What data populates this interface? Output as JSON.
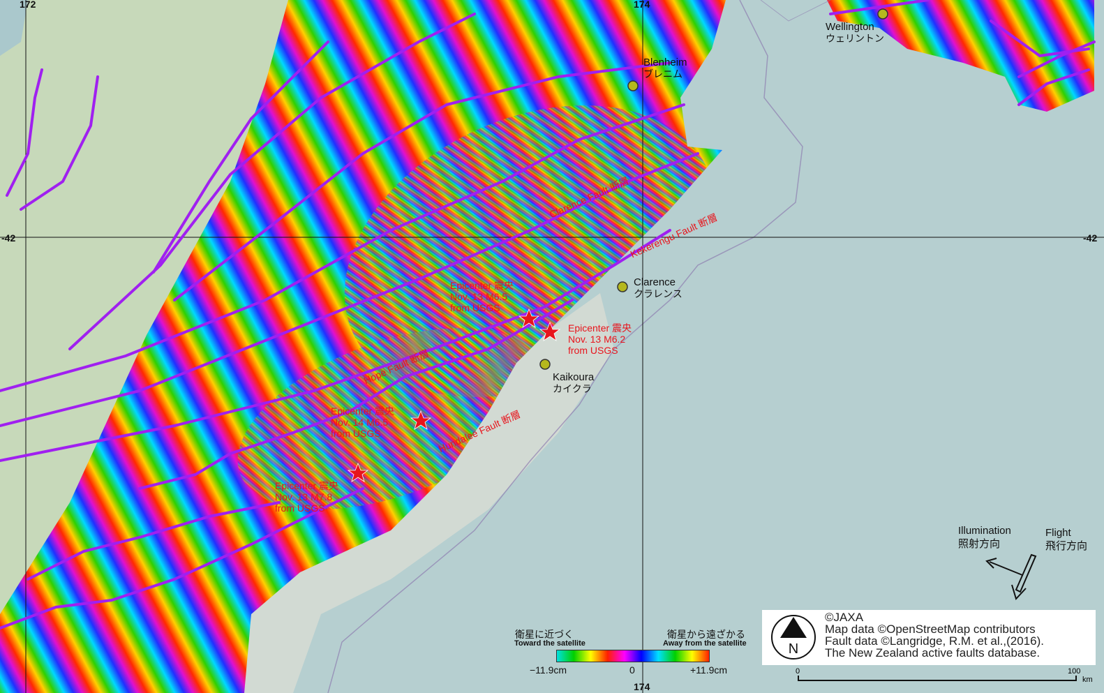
{
  "coords": {
    "lon_left": "172",
    "lon_mid": "174",
    "lat_left": "-42",
    "lat_right": "-42"
  },
  "cities": [
    {
      "en": "Wellington",
      "jp": "ウェリントン"
    },
    {
      "en": "Blenheim",
      "jp": "ブレニム"
    },
    {
      "en": "Clarence",
      "jp": "クラレンス"
    },
    {
      "en": "Kaikoura",
      "jp": "カイクラ"
    }
  ],
  "faults": [
    "Clarence Fault 断層",
    "Kekerengu Fault 断層",
    "Hope Fault 断層",
    "Hundalee Fault 断層"
  ],
  "epicenters": [
    {
      "line1": "Epicenter 震央",
      "line2": "Nov. 13 M6.5",
      "line3": "from USGS"
    },
    {
      "line1": "Epicenter 震央",
      "line2": "Nov. 13 M6.2",
      "line3": "from USGS"
    },
    {
      "line1": "Epicenter 震央",
      "line2": "Nov. 14 M6.5",
      "line3": "from USGS"
    },
    {
      "line1": "Epicenter 震央",
      "line2": "Nov. 13 M7.8",
      "line3": "from USGS"
    }
  ],
  "legend": {
    "toward_jp": "衛星に近づく",
    "toward_en": "Toward the satellite",
    "away_jp": "衛星から遠ざかる",
    "away_en": "Away from the satellite",
    "min": "−11.9cm",
    "zero": "0",
    "max": "+11.9cm",
    "colors": [
      "#00e0e0",
      "#00d000",
      "#ffff00",
      "#ff2000",
      "#ff00ff",
      "#0000ff",
      "#00e0ff",
      "#00d000",
      "#ffff00",
      "#ff2000"
    ]
  },
  "direction": {
    "illumination_en": "Illumination",
    "illumination_jp": "照射方向",
    "flight_en": "Flight",
    "flight_jp": "飛行方向"
  },
  "attribution": {
    "line1": "©JAXA",
    "line2": "Map data ©OpenStreetMap contributors",
    "line3": "Fault data ©Langridge, R.M. et al.,(2016).",
    "line4": " The New Zealand active faults database."
  },
  "scale": {
    "zero": "0",
    "max": "100",
    "unit": "km"
  },
  "north_letter": "N",
  "colors": {
    "fault_line": "#a020f0",
    "label_red": "#e8141c",
    "sea": "#b6cfd0",
    "land": "#e5e2d6",
    "forest": "#bcd6b0"
  }
}
